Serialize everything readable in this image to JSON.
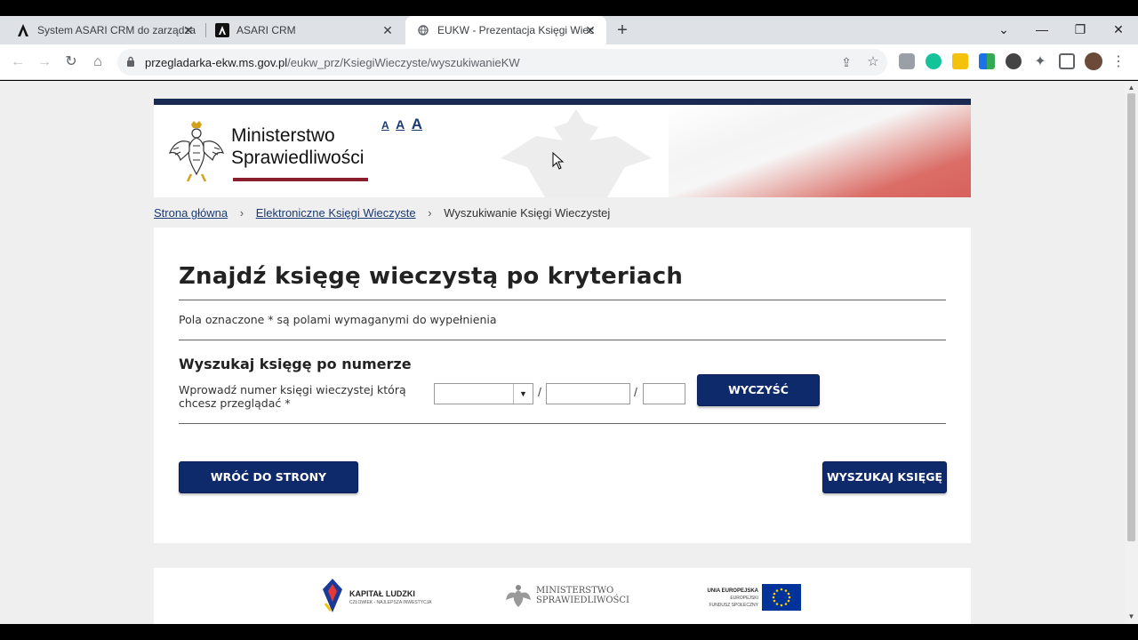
{
  "browser": {
    "tabs": [
      {
        "title": "System ASARI CRM do zarządza",
        "active": false
      },
      {
        "title": "ASARI CRM",
        "active": false
      },
      {
        "title": "EUKW - Prezentacja Księgi Wiec",
        "active": true
      }
    ],
    "url_host": "przegladarka-ekw.ms.gov.pl",
    "url_path": "/eukw_prz/KsiegiWieczyste/wyszukiwanieKW"
  },
  "header": {
    "logo_line1": "Ministerstwo",
    "logo_line2": "Sprawiedliwości",
    "font_sizes": [
      "A",
      "A",
      "A"
    ]
  },
  "breadcrumb": {
    "items": [
      "Strona główna",
      "Elektroniczne Księgi Wieczyste"
    ],
    "current": "Wyszukiwanie Księgi Wieczystej"
  },
  "form": {
    "title": "Znajdź księgę wieczystą po kryteriach",
    "required_note": "Pola oznaczone * są polami wymaganymi do wypełnienia",
    "section_title": "Wyszukaj księgę po numerze",
    "field_label": "Wprowadź numer księgi wieczystej którą chcesz przeglądać *",
    "court_code_value": "",
    "book_number_value": "",
    "check_digit_value": "",
    "separator": "/",
    "clear_button": "WYCZYŚĆ",
    "back_button": "WRÓĆ DO STRONY GŁÓWNEJ",
    "search_button": "WYSZUKAJ KSIĘGĘ"
  },
  "footer": {
    "kapital_title": "KAPITAŁ LUDZKI",
    "kapital_sub": "CZŁOWIEK - NAJLEPSZA INWESTYCJA",
    "ms_line1": "MINISTERSTWO",
    "ms_line2": "SPRAWIEDLIWOŚCI",
    "eu_line1": "UNIA EUROPEJSKA",
    "eu_line2": "EUROPEJSKI",
    "eu_line3": "FUNDUSZ SPOŁECZNY"
  },
  "colors": {
    "navy": "#0f2a6b",
    "header_bar": "#1a2a52",
    "link": "#1a3a73",
    "logo_underline": "#8b1e2e"
  }
}
